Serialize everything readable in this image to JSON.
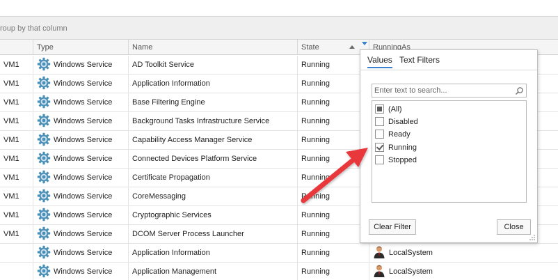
{
  "group_panel": {
    "hint": "roup by that column"
  },
  "columns": {
    "col0": "",
    "type": "Type",
    "name": "Name",
    "state": "State",
    "running_as": "RunningAs"
  },
  "rows": [
    {
      "c0": "VM1",
      "type": "Windows Service",
      "name": "AD Toolkit Service",
      "state": "Running",
      "running_as": ""
    },
    {
      "c0": "VM1",
      "type": "Windows Service",
      "name": "Application Information",
      "state": "Running",
      "running_as": ""
    },
    {
      "c0": "VM1",
      "type": "Windows Service",
      "name": "Base Filtering Engine",
      "state": "Running",
      "running_as": ""
    },
    {
      "c0": "VM1",
      "type": "Windows Service",
      "name": "Background Tasks Infrastructure Service",
      "state": "Running",
      "running_as": ""
    },
    {
      "c0": "VM1",
      "type": "Windows Service",
      "name": "Capability Access Manager Service",
      "state": "Running",
      "running_as": ""
    },
    {
      "c0": "VM1",
      "type": "Windows Service",
      "name": "Connected Devices Platform Service",
      "state": "Running",
      "running_as": ""
    },
    {
      "c0": "VM1",
      "type": "Windows Service",
      "name": "Certificate Propagation",
      "state": "Running",
      "running_as": ""
    },
    {
      "c0": "VM1",
      "type": "Windows Service",
      "name": "CoreMessaging",
      "state": "Running",
      "running_as": ""
    },
    {
      "c0": "VM1",
      "type": "Windows Service",
      "name": "Cryptographic Services",
      "state": "Running",
      "running_as": ""
    },
    {
      "c0": "VM1",
      "type": "Windows Service",
      "name": "DCOM Server Process Launcher",
      "state": "Running",
      "running_as": ""
    },
    {
      "c0": "",
      "type": "Windows Service",
      "name": "Application Information",
      "state": "Running",
      "running_as": "LocalSystem"
    },
    {
      "c0": "",
      "type": "Windows Service",
      "name": "Application Management",
      "state": "Running",
      "running_as": "LocalSystem"
    }
  ],
  "filter_popup": {
    "tab_values": "Values",
    "tab_text_filters": "Text Filters",
    "search_placeholder": "Enter text to search...",
    "items": [
      {
        "label": "(All)",
        "state": "indeterminate"
      },
      {
        "label": "Disabled",
        "state": "unchecked"
      },
      {
        "label": "Ready",
        "state": "unchecked"
      },
      {
        "label": "Running",
        "state": "checked"
      },
      {
        "label": "Stopped",
        "state": "unchecked"
      }
    ],
    "clear_filter": "Clear Filter",
    "close": "Close"
  },
  "colors": {
    "accent": "#3b7fd1",
    "arrow": "#e8383b",
    "header_bg": "#f5f5f5",
    "group_panel_bg": "#efefef"
  },
  "icons": {
    "type_icon": "gear-icon",
    "running_as_icon": "user-icon",
    "filter_icon": "filter-icon",
    "sort_icon": "sort-ascending-icon",
    "search_icon": "search-icon",
    "annotation": "red-arrow-annotation"
  }
}
